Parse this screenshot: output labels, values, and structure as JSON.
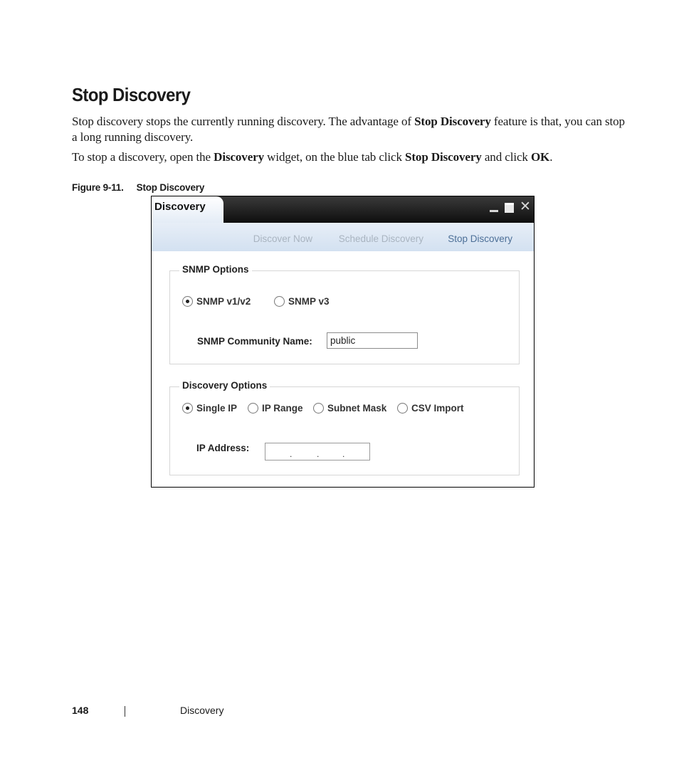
{
  "heading": "Stop Discovery",
  "para1": {
    "t1": "Stop discovery stops the currently running discovery. The advantage of ",
    "b1": "Stop Discovery",
    "t2": " feature is that, you can stop a long running discovery."
  },
  "para2": {
    "t1": "To stop a discovery, open the ",
    "b1": "Discovery",
    "t2": " widget, on the blue tab click ",
    "b2": "Stop Discovery",
    "t3": " and click ",
    "b3": "OK",
    "t4": "."
  },
  "figure": {
    "number": "Figure 9-11.",
    "title": "Stop Discovery"
  },
  "dialog": {
    "title": "Discovery",
    "controls": {
      "minimize_icon": "minimize-icon",
      "maximize_icon": "maximize-icon",
      "close_icon": "close-icon",
      "close_glyph": "✕"
    },
    "tabs": [
      {
        "label": "Discover Now",
        "state": "disabled"
      },
      {
        "label": "Schedule Discovery",
        "state": "disabled"
      },
      {
        "label": "Stop Discovery",
        "state": "active"
      }
    ],
    "snmp_options": {
      "legend": "SNMP Options",
      "radios": [
        {
          "label": "SNMP v1/v2",
          "selected": true
        },
        {
          "label": "SNMP v3",
          "selected": false
        }
      ],
      "community_label": "SNMP Community Name:",
      "community_value": "public"
    },
    "discovery_options": {
      "legend": "Discovery Options",
      "radios": [
        {
          "label": "Single IP",
          "selected": true
        },
        {
          "label": "IP Range",
          "selected": false
        },
        {
          "label": "Subnet Mask",
          "selected": false
        },
        {
          "label": "CSV Import",
          "selected": false
        }
      ],
      "ip_label": "IP Address:",
      "ip_separator": "."
    }
  },
  "colors": {
    "title_bar": "#0e0e0e",
    "tab_bar": "#d3e1f1",
    "active_tab": "#4c6f97",
    "disabled_tab": "#a9b4c0"
  },
  "footer": {
    "page_number": "148",
    "section": "Discovery"
  }
}
